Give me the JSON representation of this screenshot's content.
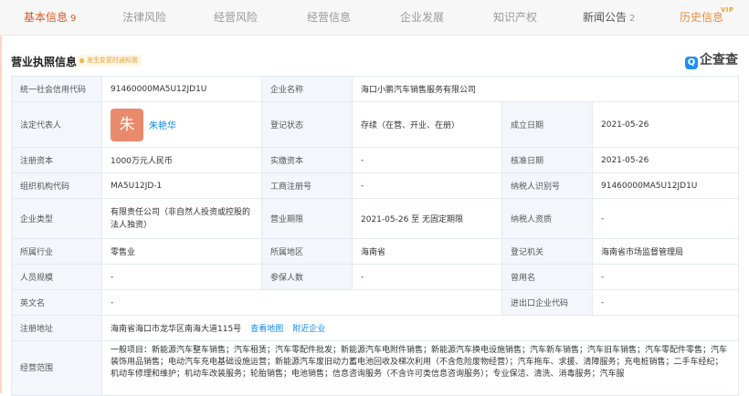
{
  "tabs": [
    {
      "label": "基本信息",
      "count": "9"
    },
    {
      "label": "法律风险",
      "count": ""
    },
    {
      "label": "经营风险",
      "count": ""
    },
    {
      "label": "经营信息",
      "count": ""
    },
    {
      "label": "企业发展",
      "count": ""
    },
    {
      "label": "知识产权",
      "count": ""
    },
    {
      "label": "新闻公告",
      "count": "2"
    },
    {
      "label": "历史信息",
      "count": ""
    }
  ],
  "vip_badge": "VIP",
  "section": {
    "title": "营业执照信息",
    "notice": "发生变更时通知我",
    "logo_text": "企查查"
  },
  "license": {
    "credit_code_label": "统一社会信用代码",
    "credit_code": "91460000MA5U12JD1U",
    "company_name_label": "企业名称",
    "company_name": "海口小鹏汽车销售服务有限公司",
    "legal_rep_label": "法定代表人",
    "legal_rep_avatar": "朱",
    "legal_rep": "朱艳华",
    "reg_status_label": "登记状态",
    "reg_status": "存续（在营、开业、在册）",
    "est_date_label": "成立日期",
    "est_date": "2021-05-26",
    "reg_capital_label": "注册资本",
    "reg_capital": "1000万元人民币",
    "paid_capital_label": "实缴资本",
    "paid_capital": "-",
    "approval_date_label": "核准日期",
    "approval_date": "2021-05-26",
    "org_code_label": "组织机构代码",
    "org_code": "MA5U12JD-1",
    "biz_reg_no_label": "工商注册号",
    "biz_reg_no": "-",
    "taxpayer_id_label": "纳税人识别号",
    "taxpayer_id": "91460000MA5U12JD1U",
    "company_type_label": "企业类型",
    "company_type": "有限责任公司（非自然人投资或控股的法人独资）",
    "biz_term_label": "营业期限",
    "biz_term": "2021-05-26 至 无固定期限",
    "taxpayer_qual_label": "纳税人资质",
    "taxpayer_qual": "-",
    "industry_label": "所属行业",
    "industry": "零售业",
    "region_label": "所属地区",
    "region": "海南省",
    "reg_authority_label": "登记机关",
    "reg_authority": "海南省市场监督管理局",
    "staff_size_label": "人员规模",
    "staff_size": "-",
    "insured_label": "参保人数",
    "insured": "-",
    "former_name_label": "曾用名",
    "former_name": "-",
    "english_name_label": "英文名",
    "english_name": "-",
    "import_export_code_label": "进出口企业代码",
    "import_export_code": "-",
    "address_label": "注册地址",
    "address": "海南省海口市龙华区南海大道115号",
    "view_map": "查看地图",
    "nearby": "附近企业",
    "scope_label": "经营范围",
    "scope": "一般项目：新能源汽车整车销售；汽车租赁；汽车零配件批发；新能源汽车电附件销售；新能源汽车换电设施销售；汽车新车销售；汽车旧车销售；汽车零配件零售；汽车装饰用品销售；电动汽车充电基础设施运营；新能源汽车废旧动力蓄电池回收及梯次利用（不含危险废物经营）；汽车拖车、求援、清障服务；充电桩销售；二手车经纪；机动车修理和维护；机动车改装服务；轮胎销售；电池销售；信息咨询服务（不含许可类信息咨询服务）；专业保洁、清洗、消毒服务；汽车服"
  }
}
